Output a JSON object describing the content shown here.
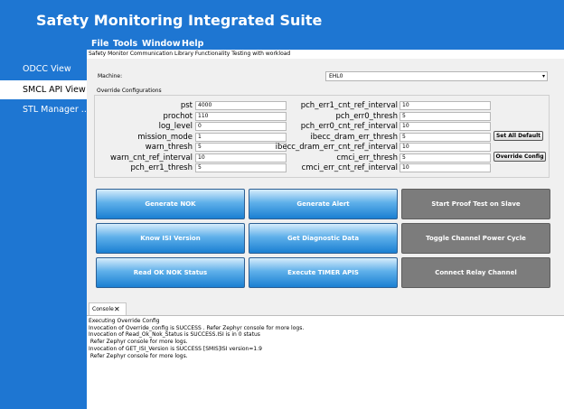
{
  "app": {
    "title": "Safety Monitoring Integrated Suite"
  },
  "menu": [
    "File",
    "Tools",
    "Window",
    "Help"
  ],
  "sidebar": {
    "items": [
      {
        "label": "ODCC View",
        "active": false
      },
      {
        "label": "SMCL API View",
        "active": true
      },
      {
        "label": "STL Manager ...",
        "active": false
      }
    ]
  },
  "main": {
    "subtitle": "Safety Monitor Communication Library Functionality Testing with workload",
    "machine": {
      "label": "Machine:",
      "value": "EHL0"
    },
    "override": {
      "title": "Override Configurations",
      "left": [
        {
          "label": "pst",
          "value": "4000"
        },
        {
          "label": "prochot",
          "value": "110"
        },
        {
          "label": "log_level",
          "value": "0"
        },
        {
          "label": "mission_mode",
          "value": "1"
        },
        {
          "label": "warn_thresh",
          "value": "5"
        },
        {
          "label": "warn_cnt_ref_interval",
          "value": "10"
        },
        {
          "label": "pch_err1_thresh",
          "value": "5"
        }
      ],
      "right": [
        {
          "label": "pch_err1_cnt_ref_interval",
          "value": "10"
        },
        {
          "label": "pch_err0_thresh",
          "value": "5"
        },
        {
          "label": "pch_err0_cnt_ref_interval",
          "value": "10"
        },
        {
          "label": "ibecc_dram_err_thresh",
          "value": "5"
        },
        {
          "label": "ibecc_dram_err_cnt_ref_interval",
          "value": "10"
        },
        {
          "label": "cmci_err_thresh",
          "value": "5"
        },
        {
          "label": "cmci_err_cnt_ref_interval",
          "value": "10"
        }
      ],
      "set_default_label": "Set All Default",
      "override_label": "Override Config"
    },
    "buttons": [
      {
        "label": "Generate NOK",
        "enabled": true
      },
      {
        "label": "Generate Alert",
        "enabled": true
      },
      {
        "label": "Start Proof Test on Slave",
        "enabled": false
      },
      {
        "label": "Know ISI Version",
        "enabled": true
      },
      {
        "label": "Get Diagnostic Data",
        "enabled": true
      },
      {
        "label": "Toggle Channel Power Cycle",
        "enabled": false
      },
      {
        "label": "Read OK NOK Status",
        "enabled": true
      },
      {
        "label": "Execute TIMER APIS",
        "enabled": true
      },
      {
        "label": "Connect Relay Channel",
        "enabled": false
      }
    ]
  },
  "console": {
    "tab_label": "Console",
    "lines": [
      "Executing Override Config",
      "Invocation of Override_config is SUCCESS . Refer Zephyr console for more logs.",
      "Invocation of Read_Ok_Nok_Status is SUCCESS.ISI is in 0 status",
      " Refer Zephyr console for more logs.",
      "Invocation of GET_ISI_Version is SUCCESS [SMIS]ISI version=1.9",
      " Refer Zephyr console for more logs."
    ]
  }
}
